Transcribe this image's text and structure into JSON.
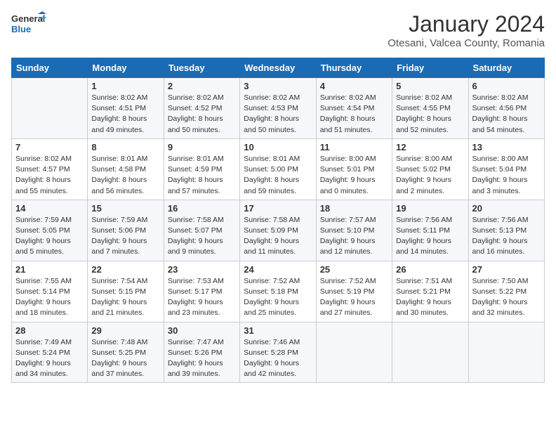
{
  "header": {
    "logo_line1": "General",
    "logo_line2": "Blue",
    "month": "January 2024",
    "location": "Otesani, Valcea County, Romania"
  },
  "weekdays": [
    "Sunday",
    "Monday",
    "Tuesday",
    "Wednesday",
    "Thursday",
    "Friday",
    "Saturday"
  ],
  "weeks": [
    [
      {
        "day": "",
        "info": ""
      },
      {
        "day": "1",
        "info": "Sunrise: 8:02 AM\nSunset: 4:51 PM\nDaylight: 8 hours\nand 49 minutes."
      },
      {
        "day": "2",
        "info": "Sunrise: 8:02 AM\nSunset: 4:52 PM\nDaylight: 8 hours\nand 50 minutes."
      },
      {
        "day": "3",
        "info": "Sunrise: 8:02 AM\nSunset: 4:53 PM\nDaylight: 8 hours\nand 50 minutes."
      },
      {
        "day": "4",
        "info": "Sunrise: 8:02 AM\nSunset: 4:54 PM\nDaylight: 8 hours\nand 51 minutes."
      },
      {
        "day": "5",
        "info": "Sunrise: 8:02 AM\nSunset: 4:55 PM\nDaylight: 8 hours\nand 52 minutes."
      },
      {
        "day": "6",
        "info": "Sunrise: 8:02 AM\nSunset: 4:56 PM\nDaylight: 8 hours\nand 54 minutes."
      }
    ],
    [
      {
        "day": "7",
        "info": "Sunrise: 8:02 AM\nSunset: 4:57 PM\nDaylight: 8 hours\nand 55 minutes."
      },
      {
        "day": "8",
        "info": "Sunrise: 8:01 AM\nSunset: 4:58 PM\nDaylight: 8 hours\nand 56 minutes."
      },
      {
        "day": "9",
        "info": "Sunrise: 8:01 AM\nSunset: 4:59 PM\nDaylight: 8 hours\nand 57 minutes."
      },
      {
        "day": "10",
        "info": "Sunrise: 8:01 AM\nSunset: 5:00 PM\nDaylight: 8 hours\nand 59 minutes."
      },
      {
        "day": "11",
        "info": "Sunrise: 8:00 AM\nSunset: 5:01 PM\nDaylight: 9 hours\nand 0 minutes."
      },
      {
        "day": "12",
        "info": "Sunrise: 8:00 AM\nSunset: 5:02 PM\nDaylight: 9 hours\nand 2 minutes."
      },
      {
        "day": "13",
        "info": "Sunrise: 8:00 AM\nSunset: 5:04 PM\nDaylight: 9 hours\nand 3 minutes."
      }
    ],
    [
      {
        "day": "14",
        "info": "Sunrise: 7:59 AM\nSunset: 5:05 PM\nDaylight: 9 hours\nand 5 minutes."
      },
      {
        "day": "15",
        "info": "Sunrise: 7:59 AM\nSunset: 5:06 PM\nDaylight: 9 hours\nand 7 minutes."
      },
      {
        "day": "16",
        "info": "Sunrise: 7:58 AM\nSunset: 5:07 PM\nDaylight: 9 hours\nand 9 minutes."
      },
      {
        "day": "17",
        "info": "Sunrise: 7:58 AM\nSunset: 5:09 PM\nDaylight: 9 hours\nand 11 minutes."
      },
      {
        "day": "18",
        "info": "Sunrise: 7:57 AM\nSunset: 5:10 PM\nDaylight: 9 hours\nand 12 minutes."
      },
      {
        "day": "19",
        "info": "Sunrise: 7:56 AM\nSunset: 5:11 PM\nDaylight: 9 hours\nand 14 minutes."
      },
      {
        "day": "20",
        "info": "Sunrise: 7:56 AM\nSunset: 5:13 PM\nDaylight: 9 hours\nand 16 minutes."
      }
    ],
    [
      {
        "day": "21",
        "info": "Sunrise: 7:55 AM\nSunset: 5:14 PM\nDaylight: 9 hours\nand 18 minutes."
      },
      {
        "day": "22",
        "info": "Sunrise: 7:54 AM\nSunset: 5:15 PM\nDaylight: 9 hours\nand 21 minutes."
      },
      {
        "day": "23",
        "info": "Sunrise: 7:53 AM\nSunset: 5:17 PM\nDaylight: 9 hours\nand 23 minutes."
      },
      {
        "day": "24",
        "info": "Sunrise: 7:52 AM\nSunset: 5:18 PM\nDaylight: 9 hours\nand 25 minutes."
      },
      {
        "day": "25",
        "info": "Sunrise: 7:52 AM\nSunset: 5:19 PM\nDaylight: 9 hours\nand 27 minutes."
      },
      {
        "day": "26",
        "info": "Sunrise: 7:51 AM\nSunset: 5:21 PM\nDaylight: 9 hours\nand 30 minutes."
      },
      {
        "day": "27",
        "info": "Sunrise: 7:50 AM\nSunset: 5:22 PM\nDaylight: 9 hours\nand 32 minutes."
      }
    ],
    [
      {
        "day": "28",
        "info": "Sunrise: 7:49 AM\nSunset: 5:24 PM\nDaylight: 9 hours\nand 34 minutes."
      },
      {
        "day": "29",
        "info": "Sunrise: 7:48 AM\nSunset: 5:25 PM\nDaylight: 9 hours\nand 37 minutes."
      },
      {
        "day": "30",
        "info": "Sunrise: 7:47 AM\nSunset: 5:26 PM\nDaylight: 9 hours\nand 39 minutes."
      },
      {
        "day": "31",
        "info": "Sunrise: 7:46 AM\nSunset: 5:28 PM\nDaylight: 9 hours\nand 42 minutes."
      },
      {
        "day": "",
        "info": ""
      },
      {
        "day": "",
        "info": ""
      },
      {
        "day": "",
        "info": ""
      }
    ]
  ]
}
